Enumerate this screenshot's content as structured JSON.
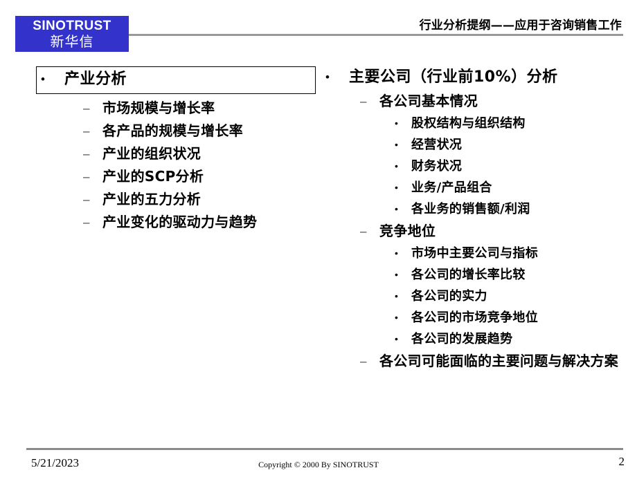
{
  "header": {
    "logo_en": "SINOTRUST",
    "logo_cn": "新华信",
    "logo_color": "#3333CC",
    "title": "行业分析提纲——应用于咨询销售工作",
    "rule_color": "#999999"
  },
  "markers": {
    "level1": "•",
    "level2": "–",
    "level3": "•"
  },
  "left_column": {
    "heading": "产业分析",
    "boxed": true,
    "items": [
      "市场规模与增长率",
      "各产品的规模与增长率",
      "产业的组织状况",
      "产业的SCP分析",
      "产业的五力分析",
      "产业变化的驱动力与趋势"
    ]
  },
  "right_column": {
    "heading": "主要公司（行业前10%）分析",
    "groups": [
      {
        "label": "各公司基本情况",
        "items": [
          "股权结构与组织结构",
          "经营状况",
          "财务状况",
          "业务/产品组合",
          "各业务的销售额/利润"
        ]
      },
      {
        "label": "竞争地位",
        "items": [
          "市场中主要公司与指标",
          "各公司的增长率比较",
          "各公司的实力",
          "各公司的市场竞争地位",
          "各公司的发展趋势"
        ]
      },
      {
        "label": "各公司可能面临的主要问题与解决方案",
        "items": []
      }
    ]
  },
  "footer": {
    "date": "5/21/2023",
    "copyright": "Copyright © 2000 By SINOTRUST",
    "page_number": "2",
    "rule_color": "#8B8B8B"
  }
}
